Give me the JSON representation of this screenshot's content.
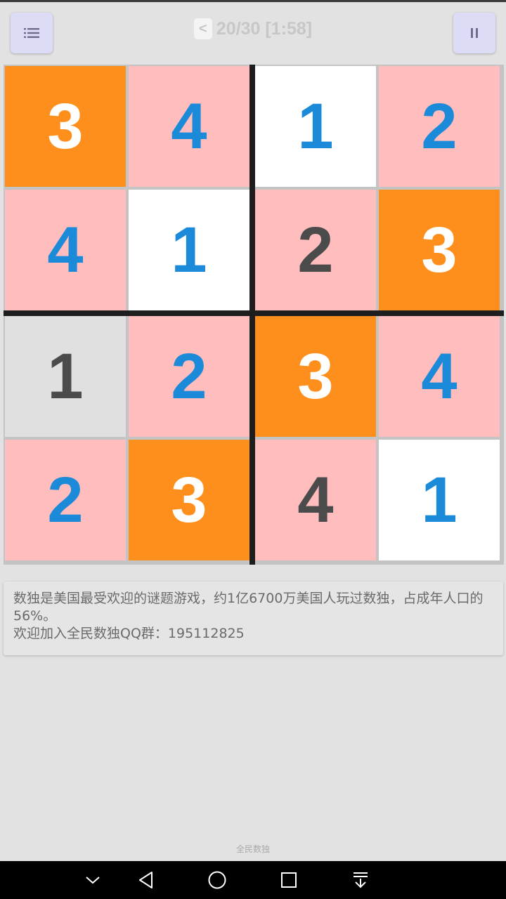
{
  "header": {
    "back_glyph": "<",
    "progress": "20/30 [1:58]",
    "menu_icon": "list-icon",
    "pause_icon": "pause-icon"
  },
  "colors": {
    "orange": "#ff8f1c",
    "pink": "#ffbdbd",
    "white": "#ffffff",
    "gray": "#e0e0e0",
    "blue_digit": "#1b8ad8",
    "dark_digit": "#4b4b4b",
    "white_digit": "#ffffff"
  },
  "board": {
    "size": 4,
    "cells": [
      {
        "value": "3",
        "bg": "orange",
        "fg": "white_digit"
      },
      {
        "value": "4",
        "bg": "pink",
        "fg": "blue_digit"
      },
      {
        "value": "1",
        "bg": "white",
        "fg": "blue_digit"
      },
      {
        "value": "2",
        "bg": "pink",
        "fg": "blue_digit"
      },
      {
        "value": "4",
        "bg": "pink",
        "fg": "blue_digit"
      },
      {
        "value": "1",
        "bg": "white",
        "fg": "blue_digit"
      },
      {
        "value": "2",
        "bg": "pink",
        "fg": "dark_digit"
      },
      {
        "value": "3",
        "bg": "orange",
        "fg": "white_digit"
      },
      {
        "value": "1",
        "bg": "gray",
        "fg": "dark_digit"
      },
      {
        "value": "2",
        "bg": "pink",
        "fg": "blue_digit"
      },
      {
        "value": "3",
        "bg": "orange",
        "fg": "white_digit"
      },
      {
        "value": "4",
        "bg": "pink",
        "fg": "blue_digit"
      },
      {
        "value": "2",
        "bg": "pink",
        "fg": "blue_digit"
      },
      {
        "value": "3",
        "bg": "orange",
        "fg": "white_digit"
      },
      {
        "value": "4",
        "bg": "pink",
        "fg": "dark_digit"
      },
      {
        "value": "1",
        "bg": "white",
        "fg": "blue_digit"
      }
    ]
  },
  "info": {
    "line1": "数独是美国最受欢迎的谜题游戏，约1亿6700万美国人玩过数独，占成年人口的56%。",
    "line2": "欢迎加入全民数独QQ群：195112825"
  },
  "footer": {
    "label": "全民数独"
  },
  "nav": {
    "icons": [
      "chevron-down-icon",
      "back-icon",
      "home-icon",
      "recents-icon",
      "pull-down-icon"
    ]
  }
}
